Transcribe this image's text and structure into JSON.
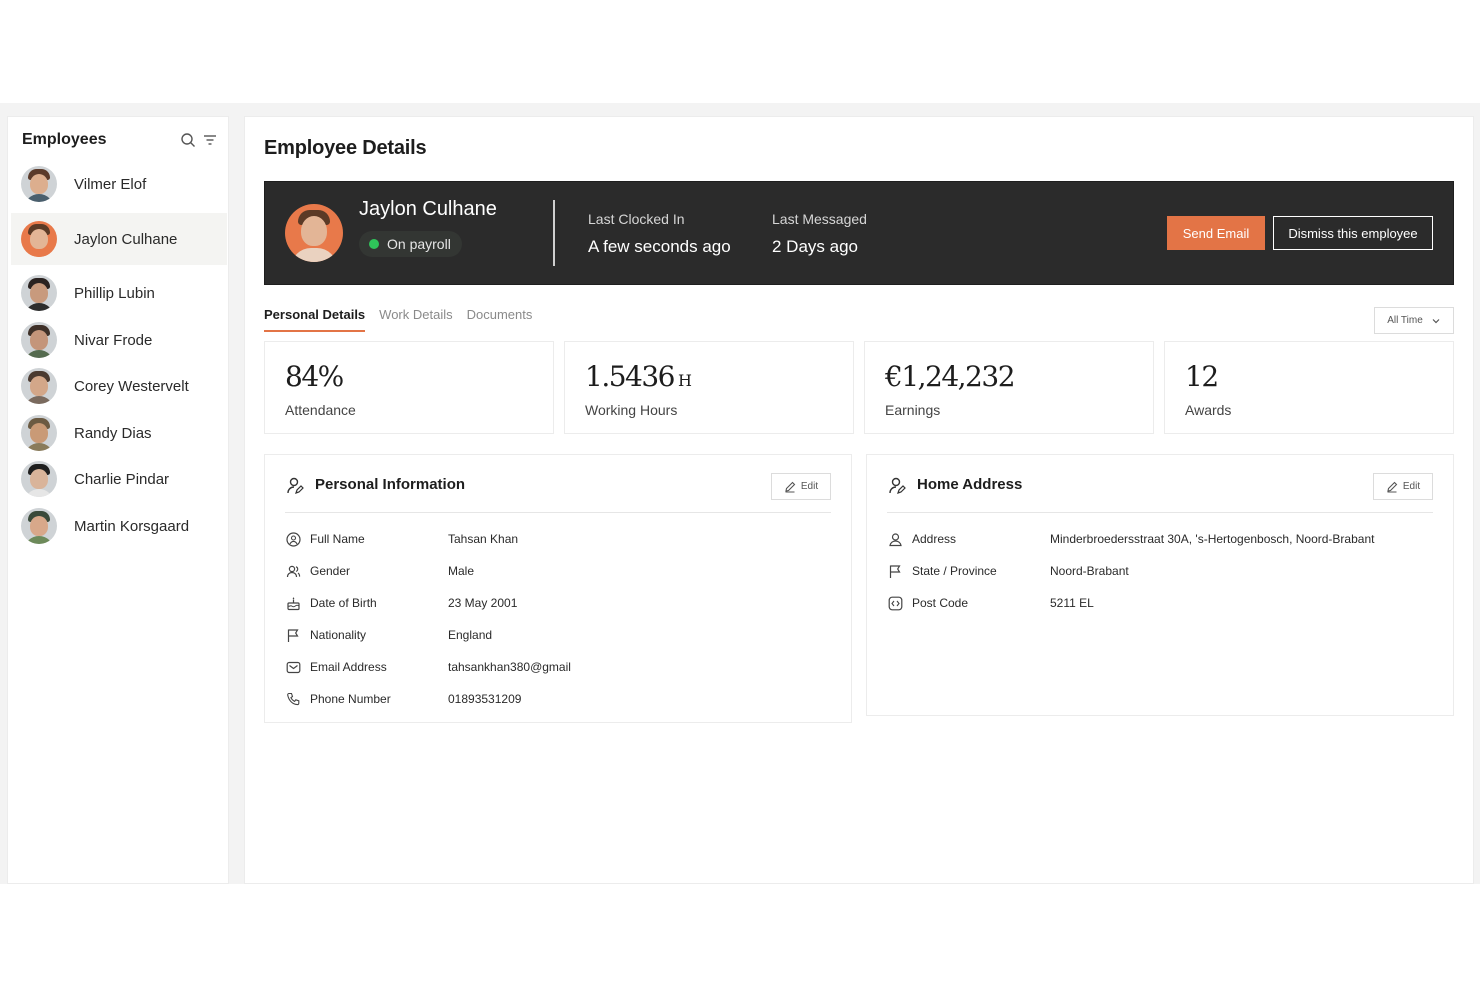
{
  "sidebar": {
    "title": "Employees",
    "employees": [
      {
        "name": "Vilmer Elof",
        "hair": "#5a3a2a",
        "skin": "#dcae8e",
        "shirt": "#4a5f6d"
      },
      {
        "name": "Jaylon Culhane",
        "hair": "#5b3a26",
        "skin": "#e3b596",
        "shirt": "#e8794a",
        "active": true
      },
      {
        "name": "Phillip Lubin",
        "hair": "#2a2220",
        "skin": "#c89a7d",
        "shirt": "#2d2d2d"
      },
      {
        "name": "Nivar Frode",
        "hair": "#3e3028",
        "skin": "#c4957a",
        "shirt": "#556b4f"
      },
      {
        "name": "Corey Westervelt",
        "hair": "#4a3a30",
        "skin": "#d3a789",
        "shirt": "#7a6a5e"
      },
      {
        "name": "Randy Dias",
        "hair": "#6b5a42",
        "skin": "#c99a76",
        "shirt": "#8a7b5a"
      },
      {
        "name": "Charlie Pindar",
        "hair": "#1f1f1f",
        "skin": "#d9b49a",
        "shirt": "#e6e6e6"
      },
      {
        "name": "Martin Korsgaard",
        "hair": "#3a4a3a",
        "skin": "#d8a88a",
        "shirt": "#6d8a5a"
      }
    ]
  },
  "main": {
    "title": "Employee Details",
    "hero": {
      "name": "Jaylon Culhane",
      "status": "On payroll",
      "last_clocked_label": "Last Clocked In",
      "last_clocked_value": "A few seconds ago",
      "last_messaged_label": "Last Messaged",
      "last_messaged_value": "2 Days ago",
      "send_email": "Send Email",
      "dismiss": "Dismiss this employee"
    },
    "tabs": [
      "Personal Details",
      "Work Details",
      "Documents"
    ],
    "range": "All Time",
    "stats": [
      {
        "value": "84%",
        "unit": "",
        "label": "Attendance"
      },
      {
        "value": "1.5436",
        "unit": "H",
        "label": "Working Hours"
      },
      {
        "value": "€1,24,232",
        "unit": "",
        "label": "Earnings"
      },
      {
        "value": "12",
        "unit": "",
        "label": "Awards"
      }
    ],
    "personal_info": {
      "title": "Personal Information",
      "edit": "Edit",
      "rows": [
        {
          "label": "Full Name",
          "value": "Tahsan Khan"
        },
        {
          "label": "Gender",
          "value": "Male"
        },
        {
          "label": "Date of Birth",
          "value": "23 May 2001"
        },
        {
          "label": "Nationality",
          "value": "England"
        },
        {
          "label": "Email Address",
          "value": "tahsankhan380@gmail"
        },
        {
          "label": "Phone Number",
          "value": "01893531209"
        }
      ]
    },
    "home_address": {
      "title": "Home Address",
      "edit": "Edit",
      "rows": [
        {
          "label": "Address",
          "value": "Minderbroedersstraat 30A, 's-Hertogenbosch, Noord-Brabant"
        },
        {
          "label": "State / Province",
          "value": "Noord-Brabant"
        },
        {
          "label": "Post Code",
          "value": "5211 EL"
        }
      ]
    },
    "accent_color": "#e37446",
    "status_color": "#2fc45a"
  }
}
